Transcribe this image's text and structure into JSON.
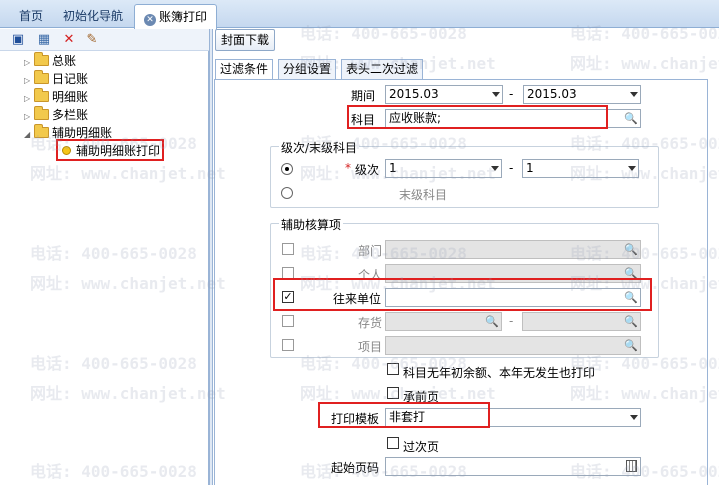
{
  "tabs": [
    {
      "label": "首页",
      "active": false
    },
    {
      "label": "初始化导航",
      "active": false
    },
    {
      "label": "账簿打印",
      "active": true,
      "icon": "close-circle-icon"
    }
  ],
  "toolbar": {
    "icons": [
      "save-icon",
      "print-preview-icon",
      "delete-icon",
      "edit-icon"
    ]
  },
  "tree": {
    "items": [
      {
        "label": "总账",
        "level": 1,
        "expanded": false
      },
      {
        "label": "日记账",
        "level": 1,
        "expanded": false
      },
      {
        "label": "明细账",
        "level": 1,
        "expanded": false
      },
      {
        "label": "多栏账",
        "level": 1,
        "expanded": false
      },
      {
        "label": "辅助明细账",
        "level": 1,
        "expanded": true
      },
      {
        "label": "辅助明细账打印",
        "level": 2,
        "selected": true
      }
    ]
  },
  "right": {
    "cover_download": "封面下载",
    "subtabs": [
      "过滤条件",
      "分组设置",
      "表头二次过滤"
    ],
    "period": {
      "label": "期间",
      "from": "2015.03",
      "sep": "-",
      "to": "2015.03"
    },
    "subject": {
      "label": "科目",
      "value": "应收账款;"
    },
    "level_group": {
      "title": "级次/末级科目",
      "level_label": "级次",
      "required_mark": "*",
      "from": "1",
      "sep": "-",
      "to": "1",
      "last_level_label": "末级科目",
      "selected": "级次"
    },
    "aux_group": {
      "title": "辅助核算项",
      "rows": [
        {
          "label": "部门",
          "checked": false,
          "enabled": false
        },
        {
          "label": "个人",
          "checked": false,
          "enabled": false
        },
        {
          "label": "往来单位",
          "checked": true,
          "enabled": true
        },
        {
          "label": "存货",
          "checked": false,
          "enabled": false
        },
        {
          "label": "项目",
          "checked": false,
          "enabled": false
        }
      ],
      "inventory_sep": "-"
    },
    "opt_print_zero": "科目无年初余额、本年无发生也打印",
    "opt_carry_forward": "承前页",
    "template": {
      "label": "打印模板",
      "value": "非套打"
    },
    "opt_subtotal_page": "过次页",
    "start_page": {
      "label": "起始页码",
      "value": ""
    }
  },
  "watermark": {
    "phone": "电话: 400-665-0028",
    "url": "网址: www.chanjet.net"
  },
  "colors": {
    "highlight_box": "#e02020",
    "tab_bar": "#c5d8ef"
  }
}
